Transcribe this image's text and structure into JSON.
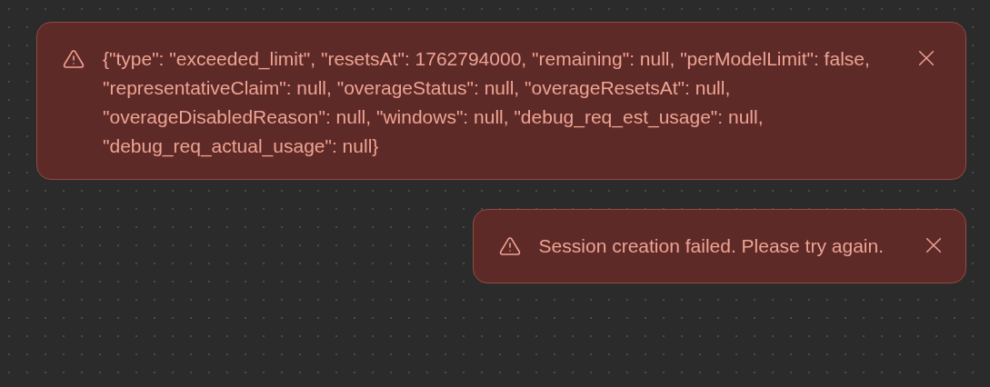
{
  "toasts": [
    {
      "kind": "error",
      "message": "{\"type\": \"exceeded_limit\", \"resetsAt\": 1762794000, \"remaining\": null, \"perModelLimit\": false, \"representativeClaim\": null, \"overageStatus\": null, \"overageResetsAt\": null, \"overageDisabledReason\": null, \"windows\": null, \"debug_req_est_usage\": null, \"debug_req_actual_usage\": null}"
    },
    {
      "kind": "error",
      "message": "Session creation failed. Please try again."
    }
  ]
}
